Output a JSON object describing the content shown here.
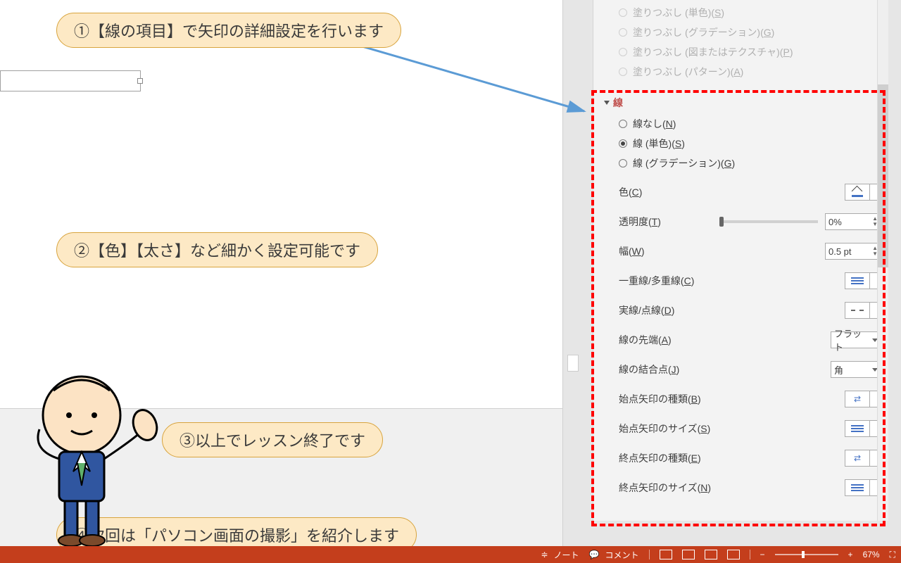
{
  "fill_options": [
    {
      "label": "塗りつぶし (単色)(S)",
      "hotkey": "S"
    },
    {
      "label": "塗りつぶし (グラデーション)(G)",
      "hotkey": "G"
    },
    {
      "label": "塗りつぶし (図またはテクスチャ)(P)",
      "hotkey": "P"
    },
    {
      "label": "塗りつぶし (パターン)(A)",
      "hotkey": "A"
    }
  ],
  "line_section": {
    "title": "線",
    "options": [
      {
        "label": "線なし(N)",
        "hotkey": "N",
        "checked": false
      },
      {
        "label": "線 (単色)(S)",
        "hotkey": "S",
        "checked": true
      },
      {
        "label": "線 (グラデーション)(G)",
        "hotkey": "G",
        "checked": false
      }
    ]
  },
  "props": {
    "color": {
      "label": "色(C)",
      "hotkey": "C"
    },
    "transparency": {
      "label": "透明度(T)",
      "hotkey": "T",
      "value": "0%"
    },
    "width": {
      "label": "幅(W)",
      "hotkey": "W",
      "value": "0.5 pt"
    },
    "compound": {
      "label": "一重線/多重線(C)",
      "hotkey": "C"
    },
    "dash": {
      "label": "実線/点線(D)",
      "hotkey": "D"
    },
    "cap": {
      "label": "線の先端(A)",
      "hotkey": "A",
      "value": "フラット"
    },
    "join": {
      "label": "線の結合点(J)",
      "hotkey": "J",
      "value": "角"
    },
    "beginType": {
      "label": "始点矢印の種類(B)",
      "hotkey": "B"
    },
    "beginSize": {
      "label": "始点矢印のサイズ(S)",
      "hotkey": "S"
    },
    "endType": {
      "label": "終点矢印の種類(E)",
      "hotkey": "E"
    },
    "endSize": {
      "label": "終点矢印のサイズ(N)",
      "hotkey": "N"
    }
  },
  "callouts": {
    "c1": "①【線の項目】で矢印の詳細設定を行います",
    "c2": "②【色】【太さ】など細かく設定可能です",
    "c3": "③以上でレッスン終了です",
    "c4": "④次回は「パソコン画面の撮影」を紹介します"
  },
  "statusbar": {
    "notes": "ノート",
    "comments": "コメント",
    "zoom": "67%"
  }
}
